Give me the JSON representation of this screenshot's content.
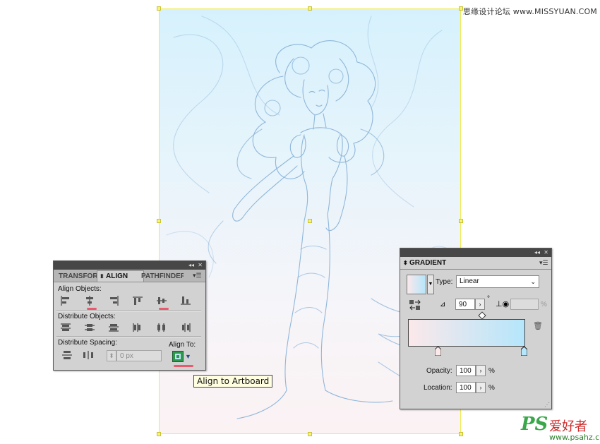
{
  "watermark": {
    "top_text": "思缘设计论坛 www.MISSYUAN.COM",
    "logo_ps": "PS",
    "logo_cn": "爱好者",
    "url": "www.psahz.com"
  },
  "align_panel": {
    "tabs": [
      {
        "label": "TRANSFORM"
      },
      {
        "label": "ALIGN",
        "active": true
      },
      {
        "label": "PATHFINDER"
      }
    ],
    "align_objects_label": "Align Objects:",
    "distribute_objects_label": "Distribute Objects:",
    "distribute_spacing_label": "Distribute Spacing:",
    "align_to_label": "Align To:",
    "spacing_value": "0 px",
    "tooltip": "Align to Artboard"
  },
  "gradient_panel": {
    "title": "GRADIENT",
    "type_label": "Type:",
    "type_value": "Linear",
    "angle_value": "90",
    "degree_symbol": "°",
    "aspect_unit": "%",
    "opacity_label": "Opacity:",
    "opacity_value": "100",
    "location_label": "Location:",
    "location_value": "100",
    "percent": "%",
    "gradient_start_color": "#fbe8ea",
    "gradient_end_color": "#b5e6fb"
  },
  "colors": {
    "artboard_border": "#f0ec52",
    "panel_bg": "#d2d2d2",
    "highlight_mark": "#e85b6c"
  }
}
